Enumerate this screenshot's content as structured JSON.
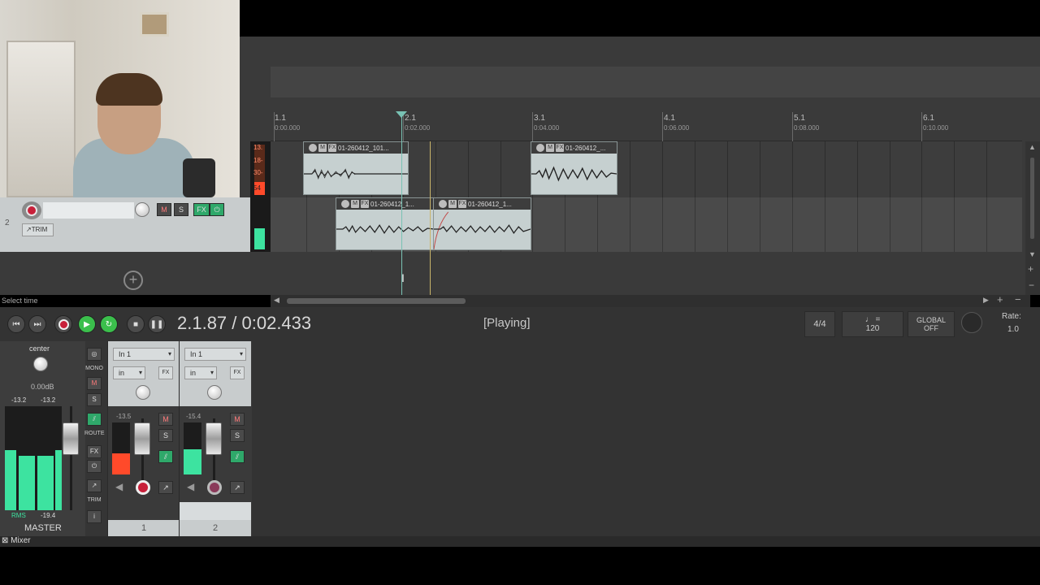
{
  "ruler": {
    "marks": [
      {
        "bar": "1.1",
        "time": "0:00.000"
      },
      {
        "bar": "2.1",
        "time": "0:02.000"
      },
      {
        "bar": "3.1",
        "time": "0:04.000"
      },
      {
        "bar": "4.1",
        "time": "0:06.000"
      },
      {
        "bar": "5.1",
        "time": "0:08.000"
      },
      {
        "bar": "6.1",
        "time": "0:10.000"
      }
    ]
  },
  "tracks": {
    "track2_number": "2",
    "trim_label": "TRIM",
    "mute": "M",
    "solo": "S",
    "fx": "FX",
    "meter1_labels": [
      "13.",
      "18-",
      "30-",
      "54"
    ]
  },
  "items": {
    "lane1_a": "01-260412_101...",
    "lane1_b": "01-260412_...",
    "lane2_a": "01-260412_1...",
    "lane2_b": "01-260412_1...",
    "btn_m": "M",
    "btn_fx": "FX"
  },
  "transport": {
    "position": "2.1.87 / 0:02.433",
    "status": "[Playing]",
    "status_hint": "Select time",
    "time_sig": "4/4",
    "tempo_note": "♩ =",
    "tempo": "120",
    "global_label": "GLOBAL",
    "global_state": "OFF",
    "rate_label": "Rate:",
    "rate": "1.0"
  },
  "mixer": {
    "master": {
      "pan": "center",
      "volume": "0.00dB",
      "peak_l": "-13.2",
      "peak_r": "-13.2",
      "rms_label": "RMS",
      "rms_value": "-19.4",
      "name": "MASTER"
    },
    "side": {
      "mono": "MONO",
      "m": "M",
      "s": "S",
      "route": "ROUTE",
      "fx": "FX",
      "trim": "TRIM",
      "info": "i"
    },
    "channels": [
      {
        "input": "In 1",
        "mode": "in",
        "peak": "-13.5",
        "number": "1"
      },
      {
        "input": "In 1",
        "mode": "in",
        "peak": "-15.4",
        "number": "2"
      }
    ],
    "ch_mute": "M",
    "ch_solo": "S",
    "fx_button": "FX"
  },
  "footer": {
    "mixer_tab": "Mixer"
  },
  "colors": {
    "meter_green": "#3de3a0",
    "clip_red": "#ff4a2a",
    "record_red": "#c8203a",
    "play_green": "#3bbf4c",
    "edit_cursor": "#79c2b4"
  }
}
